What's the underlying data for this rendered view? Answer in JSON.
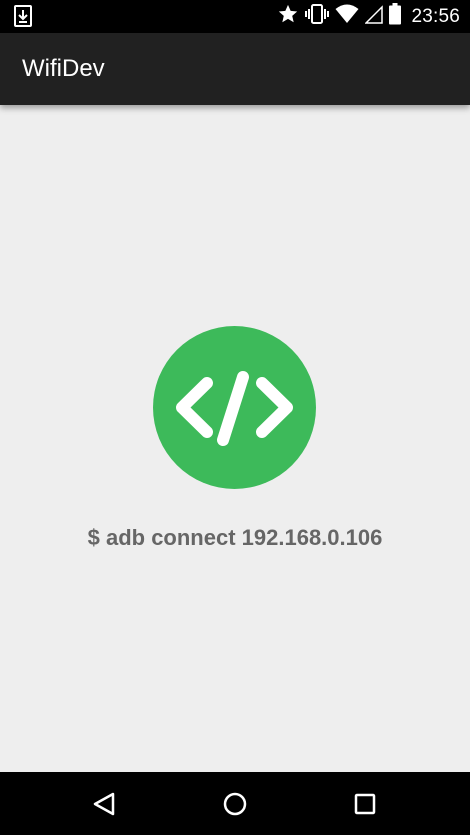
{
  "status_bar": {
    "time": "23:56",
    "icons": [
      "download-icon",
      "star-icon",
      "vibrate-icon",
      "wifi-icon",
      "signal-icon",
      "battery-icon"
    ]
  },
  "app_bar": {
    "title": "WifiDev"
  },
  "main": {
    "badge_icon": "code-icon",
    "badge_color": "#3dba5a",
    "command": "$ adb connect 192.168.0.106"
  },
  "nav_bar": {
    "buttons": [
      "back-icon",
      "home-icon",
      "recents-icon"
    ]
  }
}
